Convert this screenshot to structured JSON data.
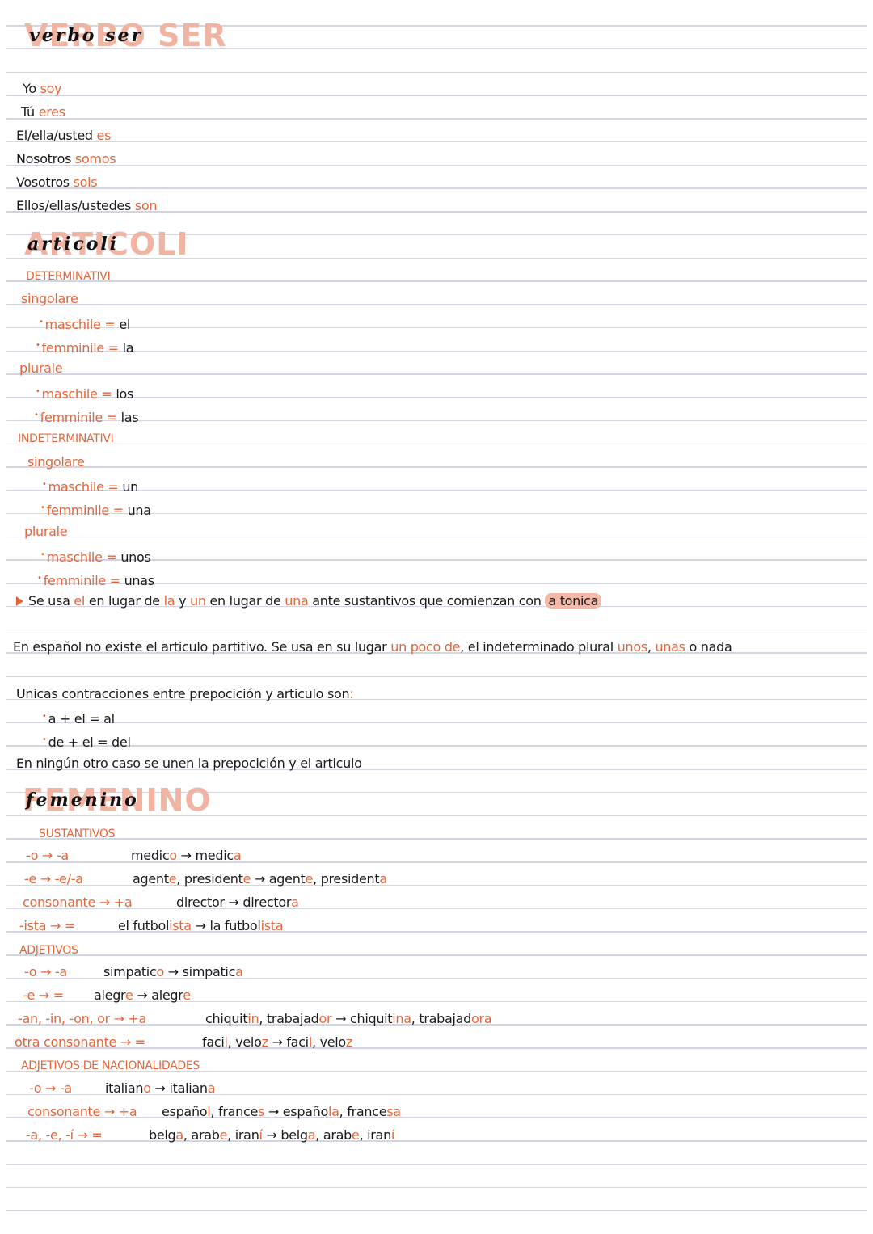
{
  "verbo_ser": {
    "heading_bg": "VERBO SER",
    "heading_script": "verbo ser",
    "conjugations": [
      {
        "pronoun": "Yo",
        "form": "soy"
      },
      {
        "pronoun": "Tú",
        "form": "eres"
      },
      {
        "pronoun": "El/ella/usted",
        "form": "es"
      },
      {
        "pronoun": "Nosotros",
        "form": "somos"
      },
      {
        "pronoun": "Vosotros",
        "form": "sois"
      },
      {
        "pronoun": "Ellos/ellas/ustedes",
        "form": "son"
      }
    ]
  },
  "articoli": {
    "heading_bg": "ARTICOLI",
    "heading_script": "articoli",
    "determinativi": {
      "title": "DETERMINATIVI",
      "singolare": "singolare",
      "sing_masc_label": "maschile =",
      "sing_masc_value": "el",
      "sing_fem_label": "femminile =",
      "sing_fem_value": "la",
      "plurale": "plurale",
      "plur_masc_label": "maschile =",
      "plur_masc_value": "los",
      "plur_fem_label": "femminile =",
      "plur_fem_value": "las"
    },
    "indeterminativi": {
      "title": "INDETERMINATIVI",
      "singolare": "singolare",
      "sing_masc_label": "maschile =",
      "sing_masc_value": "un",
      "sing_fem_label": "femminile =",
      "sing_fem_value": "una",
      "plurale": "plurale",
      "plur_masc_label": "maschile =",
      "plur_masc_value": "unos",
      "plur_fem_label": "femminile =",
      "plur_fem_value": "unas"
    },
    "note": {
      "p1": "Se usa ",
      "el": "el",
      "p2": " en lugar de ",
      "la": "la",
      "p3": " y ",
      "un": "un",
      "p4": " en lugar de ",
      "una": "una",
      "p5": " ante sustantivos que comienzan con ",
      "highlight": "a tonica"
    },
    "partitivo": {
      "p1": "En español no existe el articulo partitivo. Se usa en su lugar ",
      "o1": "un poco de",
      "p2": ", el indeterminado plural ",
      "o2": "unos",
      "p3": ", ",
      "o3": "unas",
      "p4": " o nada"
    },
    "contracciones": {
      "intro": "Unicas contracciones entre prepocición y articulo son",
      "colon": ":",
      "c1": "a + el = al",
      "c2": "de + el = del",
      "outro": "En ningún otro caso se unen la prepocición y el articulo"
    }
  },
  "femenino": {
    "heading_bg": "FEMENINO",
    "heading_script": "femenino",
    "sustantivos": {
      "title": "SUSTANTIVOS",
      "rows": [
        {
          "rule": "-o → -a",
          "ex": [
            [
              "medic",
              ""
            ],
            [
              "o",
              "o"
            ],
            [
              " → medic",
              ""
            ],
            [
              "a",
              "o"
            ]
          ]
        },
        {
          "rule": "-e → -e/-a",
          "ex": [
            [
              "agent",
              ""
            ],
            [
              "e",
              "o"
            ],
            [
              ", president",
              ""
            ],
            [
              "e",
              "o"
            ],
            [
              " → agent",
              ""
            ],
            [
              "e",
              "o"
            ],
            [
              ", president",
              ""
            ],
            [
              "a",
              "o"
            ]
          ]
        },
        {
          "rule": "consonante → +a",
          "ex": [
            [
              "director",
              ""
            ],
            [
              "",
              ""
            ],
            [
              " → director",
              ""
            ],
            [
              "a",
              "o"
            ]
          ]
        },
        {
          "rule": "-ista → =",
          "ex": [
            [
              "el futbol",
              ""
            ],
            [
              "ista",
              "o"
            ],
            [
              " → la futbol",
              ""
            ],
            [
              "ista",
              "o"
            ]
          ]
        }
      ]
    },
    "adjetivos": {
      "title": "ADJETIVOS",
      "rows": [
        {
          "rule": "-o → -a",
          "ex": [
            [
              "simpatic",
              ""
            ],
            [
              "o",
              "o"
            ],
            [
              " → simpatic",
              ""
            ],
            [
              "a",
              "o"
            ]
          ]
        },
        {
          "rule": "-e → =",
          "ex": [
            [
              "alegr",
              ""
            ],
            [
              "e",
              "o"
            ],
            [
              " → alegr",
              ""
            ],
            [
              "e",
              "o"
            ]
          ]
        },
        {
          "rule": "-an, -in, -on, or → +a",
          "ex": [
            [
              "chiquit",
              ""
            ],
            [
              "in",
              "o"
            ],
            [
              ", trabajad",
              ""
            ],
            [
              "or",
              "o"
            ],
            [
              " → chiquit",
              ""
            ],
            [
              "ina",
              "o"
            ],
            [
              ", trabajad",
              ""
            ],
            [
              "ora",
              "o"
            ]
          ]
        },
        {
          "rule": "otra consonante → =",
          "ex": [
            [
              "faci",
              ""
            ],
            [
              "l",
              "o"
            ],
            [
              ", velo",
              ""
            ],
            [
              "z",
              "o"
            ],
            [
              " → faci",
              ""
            ],
            [
              "l",
              "o"
            ],
            [
              ", velo",
              ""
            ],
            [
              "z",
              "o"
            ]
          ]
        }
      ]
    },
    "nacionalidades": {
      "title": "ADJETIVOS DE NACIONALIDADES",
      "rows": [
        {
          "rule": "-o → -a",
          "ex": [
            [
              "italian",
              ""
            ],
            [
              "o",
              "o"
            ],
            [
              " → italian",
              ""
            ],
            [
              "a",
              "o"
            ]
          ]
        },
        {
          "rule": "consonante → +a",
          "ex": [
            [
              "españo",
              ""
            ],
            [
              "l",
              "o"
            ],
            [
              ", france",
              ""
            ],
            [
              "s",
              "o"
            ],
            [
              " → españo",
              ""
            ],
            [
              "la",
              "o"
            ],
            [
              ", france",
              ""
            ],
            [
              "sa",
              "o"
            ]
          ]
        },
        {
          "rule": "-a, -e, -í → =",
          "ex": [
            [
              "belg",
              ""
            ],
            [
              "a",
              "o"
            ],
            [
              ", arab",
              ""
            ],
            [
              "e",
              "o"
            ],
            [
              ", iran",
              ""
            ],
            [
              "í",
              "o"
            ],
            [
              " → belg",
              ""
            ],
            [
              "a",
              "o"
            ],
            [
              ", arab",
              ""
            ],
            [
              "e",
              "o"
            ],
            [
              ", iran",
              ""
            ],
            [
              "í",
              "o"
            ]
          ]
        }
      ]
    }
  },
  "colors": {
    "accent": "#e4653a",
    "heading_bg": "#f1b3a2",
    "highlight": "#f5b8a6",
    "rule": "#d3d5e3",
    "ink": "#1a1a1a"
  }
}
